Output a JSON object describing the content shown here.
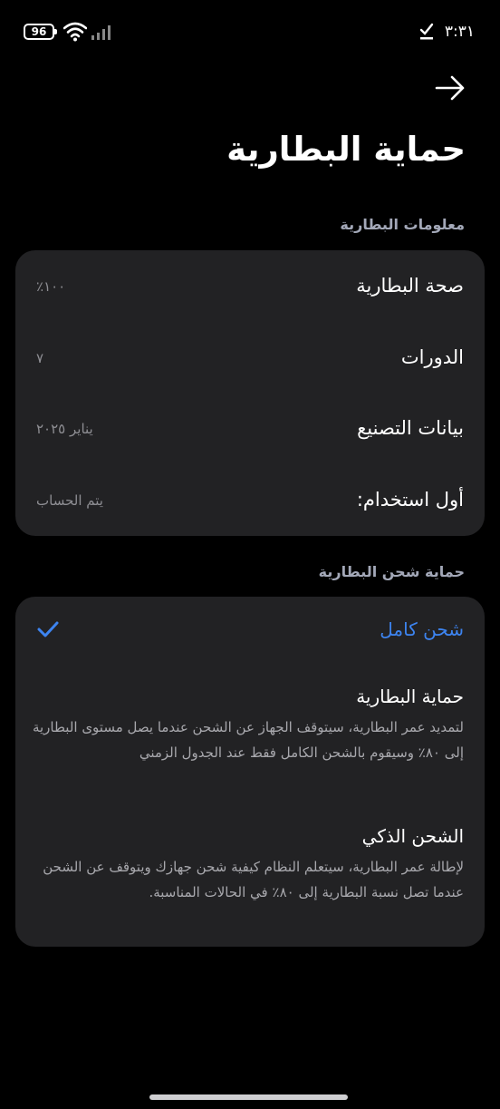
{
  "status_bar": {
    "battery_level": "96",
    "time": "٣:٣١",
    "icons": [
      "battery-icon",
      "wifi-icon",
      "signal-icon",
      "notification-check-icon"
    ]
  },
  "header": {
    "back_icon": "arrow-right-icon",
    "title": "حماية البطارية"
  },
  "battery_info": {
    "section_title": "معلومات البطارية",
    "rows": [
      {
        "label": "صحة البطارية",
        "value": "١٠٠٪"
      },
      {
        "label": "الدورات",
        "value": "٧"
      },
      {
        "label": "بيانات التصنيع",
        "value": "يناير ٢٠٢٥"
      },
      {
        "label": "أول استخدام:",
        "value": "يتم الحساب"
      }
    ]
  },
  "charging_protection": {
    "section_title": "حماية شحن البطارية",
    "options": [
      {
        "title": "شحن كامل",
        "description": "",
        "selected": true
      },
      {
        "title": "حماية البطارية",
        "description": "لتمديد عمر البطارية، سيتوقف الجهاز عن الشحن عندما يصل مستوى البطارية إلى ٨٠٪ وسيقوم بالشحن الكامل فقط عند الجدول الزمني",
        "selected": false
      },
      {
        "title": "الشحن الذكي",
        "description": "لإطالة عمر البطارية، سيتعلم النظام كيفية شحن جهازك ويتوقف عن الشحن عندما تصل نسبة البطارية إلى ٨٠٪ في الحالات المناسبة.",
        "selected": false
      }
    ]
  },
  "colors": {
    "background": "#000000",
    "card": "#222224",
    "accent": "#3d84f0",
    "secondary_text": "#8e8e93",
    "section_label": "#a3a8b8"
  }
}
